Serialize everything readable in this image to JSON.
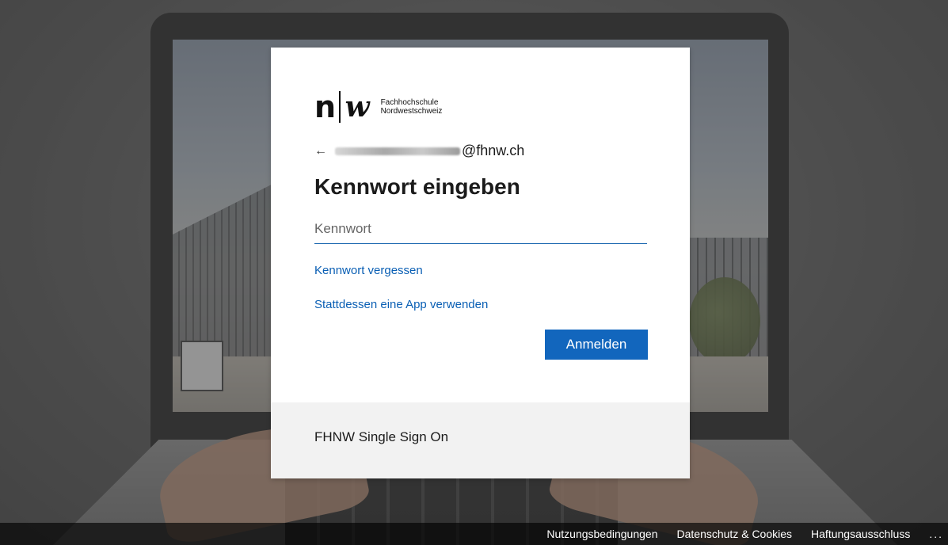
{
  "brand": {
    "logo_n": "n",
    "logo_w": "w",
    "logo_line1": "Fachhochschule",
    "logo_line2": "Nordwestschweiz"
  },
  "identity": {
    "back_icon": "←",
    "email_suffix": "@fhnw.ch"
  },
  "page": {
    "title": "Kennwort eingeben"
  },
  "password_field": {
    "placeholder": "Kennwort",
    "value": ""
  },
  "links": {
    "forgot_password": "Kennwort vergessen",
    "use_app": "Stattdessen eine App verwenden"
  },
  "buttons": {
    "sign_in": "Anmelden"
  },
  "card_footer": {
    "text": "FHNW Single Sign On"
  },
  "bottom_bar": {
    "terms": "Nutzungsbedingungen",
    "privacy": "Datenschutz & Cookies",
    "disclaimer": "Haftungsausschluss",
    "more": "..."
  },
  "colors": {
    "accent": "#1266bd",
    "link": "#0a5fb4",
    "footer_bg": "#f2f2f2"
  }
}
